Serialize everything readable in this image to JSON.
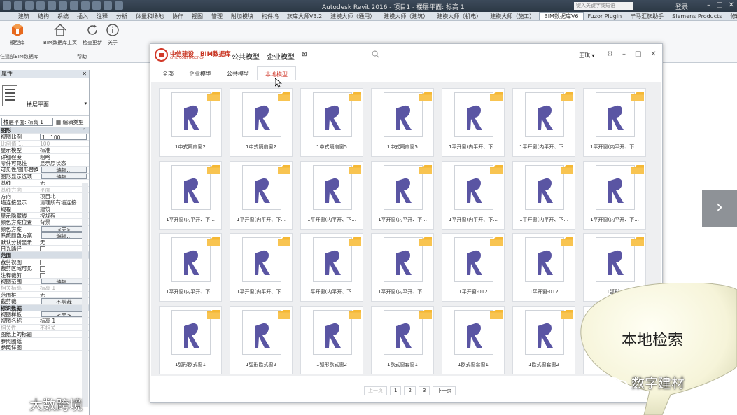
{
  "titlebar": {
    "app_title": "Autodesk Revit 2016 -   项目1 - 楼层平面: 标高 1",
    "help_search_placeholder": "键入关键字或短语",
    "login": "登录"
  },
  "ribbon_tabs": [
    "建筑",
    "结构",
    "系统",
    "插入",
    "注释",
    "分析",
    "体量和场地",
    "协作",
    "视图",
    "管理",
    "附加模块",
    "构件坞",
    "族库大师V3.2",
    "建模大师（通用）",
    "建模大师（建筑）",
    "建模大师（机电）",
    "建模大师（施工）",
    "BIM数据库V6",
    "Fuzor Plugin",
    "毕马汇族助手",
    "Siemens Products",
    "修改"
  ],
  "ribbon_active_tab": "BIM数据库V6",
  "ribbon": {
    "buttons": [
      {
        "label": "模型库"
      },
      {
        "label": "BIM数据库主页"
      },
      {
        "label": "检查更新"
      },
      {
        "label": "关于"
      }
    ],
    "group_labels": [
      "住建部BIM数据库",
      "帮助"
    ]
  },
  "properties": {
    "header": "属性",
    "type_name": "楼层平面",
    "filter_value": "楼层平面: 标高 1",
    "edit_type_label": "编辑类型",
    "rows": [
      {
        "k": "图形",
        "section": true
      },
      {
        "k": "视图比例",
        "v": "1 : 100",
        "style": "box"
      },
      {
        "k": "比例值 1:",
        "v": "100",
        "grey": true
      },
      {
        "k": "显示模型",
        "v": "标准"
      },
      {
        "k": "详细程度",
        "v": "粗略"
      },
      {
        "k": "零件可见性",
        "v": "显示原状态"
      },
      {
        "k": "可见性/图形替换",
        "v": "编辑...",
        "style": "btn"
      },
      {
        "k": "图形显示选项",
        "v": "编辑...",
        "style": "btn"
      },
      {
        "k": "基线",
        "v": "无"
      },
      {
        "k": "基线方向",
        "v": "平面",
        "grey": true
      },
      {
        "k": "方向",
        "v": "项目北"
      },
      {
        "k": "墙连接显示",
        "v": "清理所有墙连接"
      },
      {
        "k": "规程",
        "v": "建筑"
      },
      {
        "k": "显示隐藏线",
        "v": "按规程"
      },
      {
        "k": "颜色方案位置",
        "v": "背景"
      },
      {
        "k": "颜色方案",
        "v": "<无>",
        "style": "btn"
      },
      {
        "k": "系统颜色方案",
        "v": "编辑...",
        "style": "btn"
      },
      {
        "k": "默认分析显示...",
        "v": "无"
      },
      {
        "k": "日光路径",
        "v": "",
        "style": "cb"
      },
      {
        "k": "范围",
        "section": true
      },
      {
        "k": "裁剪视图",
        "v": "",
        "style": "cb"
      },
      {
        "k": "裁剪区域可见",
        "v": "",
        "style": "cb"
      },
      {
        "k": "注释裁剪",
        "v": "",
        "style": "cb"
      },
      {
        "k": "视图范围",
        "v": "编辑...",
        "style": "btn"
      },
      {
        "k": "相关标高",
        "v": "标高 1",
        "grey": true
      },
      {
        "k": "范围框",
        "v": "无"
      },
      {
        "k": "截剪裁",
        "v": "不剪裁",
        "style": "btn"
      },
      {
        "k": "标识数据",
        "section": true
      },
      {
        "k": "视图样板",
        "v": "<无>",
        "style": "btn"
      },
      {
        "k": "视图名称",
        "v": "标高 1"
      },
      {
        "k": "相关性",
        "v": "不相关",
        "grey": true
      },
      {
        "k": "图纸上的标题",
        "v": ""
      },
      {
        "k": "参照图纸",
        "v": ""
      },
      {
        "k": "参照详图",
        "v": ""
      }
    ]
  },
  "dialog": {
    "brand": "中信建设 | BIM数据库",
    "brand_en": "CITIC CONSTRUCTION",
    "nav": [
      "公共模型",
      "企业模型"
    ],
    "user": "王琪 ▾",
    "tabs": [
      "全部",
      "企业模型",
      "公共模型",
      "本地模型"
    ],
    "active_tab": "本地模型",
    "items": [
      "1中式隔扇窗2",
      "1中式隔扇窗2",
      "1中式隔扇窗5",
      "1中式隔扇窗5",
      "1平开窗(内平开、下...",
      "1平开窗(内平开、下...",
      "1平开窗(内平开、下...",
      "1平开窗(内平开、下...",
      "1平开窗(内平开、下...",
      "1平开窗(内平开、下...",
      "1平开窗(内平开、下...",
      "1平开窗(内平开、下...",
      "1平开窗(内平开、下...",
      "1平开窗(内平开、下...",
      "1平开窗(内平开、下...",
      "1平开窗(内平开、下...",
      "1平开窗(内平开、下...",
      "1平开窗(内平开、下...",
      "1平开窗-012",
      "1平开窗-012",
      "1弧形..",
      "1弧形欧式窗1",
      "1弧形欧式窗2",
      "1弧形欧式窗2",
      "1欧式窗套窗1",
      "1欧式窗套窗1",
      "1欧式窗套窗2",
      "1欧式窗套窗2"
    ],
    "pager": {
      "prev": "上一页",
      "pages": [
        "1",
        "2",
        "3"
      ],
      "next": "下一页"
    }
  },
  "overlay": {
    "balloon_text": "本地检索",
    "watermark_right": "数字建材",
    "watermark_left": "大数跨境"
  },
  "colors": {
    "accent_red": "#c8321f",
    "folder_orange": "#f5b835",
    "revit_purple": "#5a55a3"
  }
}
